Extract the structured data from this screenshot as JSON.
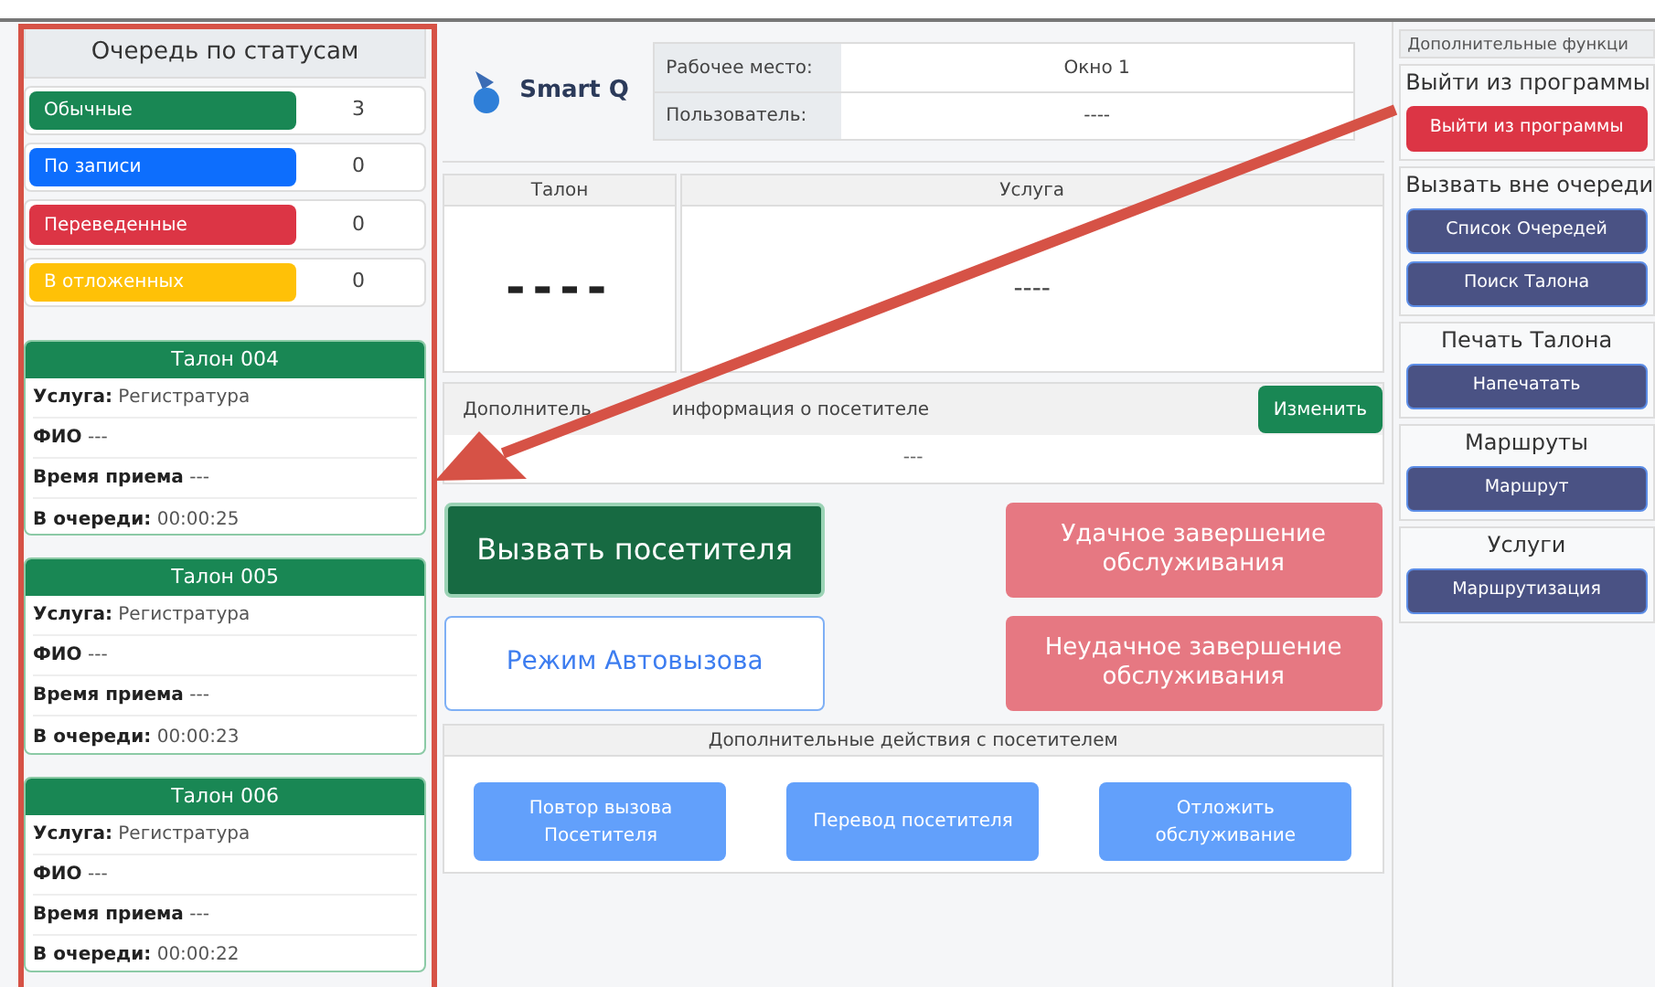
{
  "queue_panel": {
    "title": "Очередь по статусам",
    "statuses": [
      {
        "label": "Обычные",
        "count": "3",
        "color": "#198754"
      },
      {
        "label": "По записи",
        "count": "0",
        "color": "#0d6efd"
      },
      {
        "label": "Переведенные",
        "count": "0",
        "color": "#dc3545"
      },
      {
        "label": "В отложенных",
        "count": "0",
        "color": "#ffc107"
      }
    ],
    "tickets": [
      {
        "title": "Талон 004",
        "lines": [
          "**Услуга:** Регистратура",
          "**ФИО** ---",
          "**Время приема** ---",
          "**В очереди:** 00:00:25"
        ]
      },
      {
        "title": "Талон 005",
        "lines": [
          "**Услуга:** Регистратура",
          "**ФИО** ---",
          "**Время приема** ---",
          "**В очереди:** 00:00:23"
        ]
      },
      {
        "title": "Талон 006",
        "lines": [
          "**Услуга:** Регистратура",
          "**ФИО** ---",
          "**Время приема** ---",
          "**В очереди:** 00:00:22"
        ]
      }
    ]
  },
  "header": {
    "logo_text": "Smart Q",
    "info": [
      {
        "label": "Рабочее место:",
        "value": "Окно 1"
      },
      {
        "label": "Пользователь:",
        "value": "----"
      }
    ]
  },
  "current": {
    "columns": [
      {
        "heading": "Талон",
        "value": "----",
        "kind": "large"
      },
      {
        "heading": "Услуга",
        "value": "----",
        "kind": "small"
      }
    ]
  },
  "visitor_info": {
    "title_parts": [
      "Дополнитель",
      "информация о посетителе"
    ],
    "button": "Изменить",
    "value": "---"
  },
  "main_actions": [
    {
      "label": "Вызвать посетителя",
      "kind": "primary"
    },
    {
      "label": "Удачное завершение обслуживания",
      "kind": "danger"
    },
    {
      "label": "Режим Автовызова",
      "kind": "outline"
    },
    {
      "label": "Неудачное завершение обслуживания",
      "kind": "danger"
    }
  ],
  "extra_actions": {
    "title": "Дополнительные действия с посетителем",
    "buttons": [
      "Повтор вызова Посетителя",
      "Перевод посетителя",
      "Отложить обслуживание"
    ]
  },
  "sidebar": {
    "title": "Дополнительные функци",
    "sections": [
      {
        "title": "Выйти из программы",
        "buttons": [
          {
            "label": "Выйти из программы",
            "kind": "danger"
          }
        ]
      },
      {
        "title": "Вызвать вне очереди",
        "buttons": [
          {
            "label": "Список Очередей",
            "kind": "indigo"
          },
          {
            "label": "Поиск Талона",
            "kind": "indigo"
          }
        ]
      },
      {
        "title": "Печать Талона",
        "buttons": [
          {
            "label": "Напечатать",
            "kind": "indigo"
          }
        ]
      },
      {
        "title": "Маршруты",
        "buttons": [
          {
            "label": "Маршрут",
            "kind": "indigo"
          }
        ]
      },
      {
        "title": "Услуги",
        "buttons": [
          {
            "label": "Маршрутизация",
            "kind": "indigo"
          }
        ]
      }
    ]
  }
}
